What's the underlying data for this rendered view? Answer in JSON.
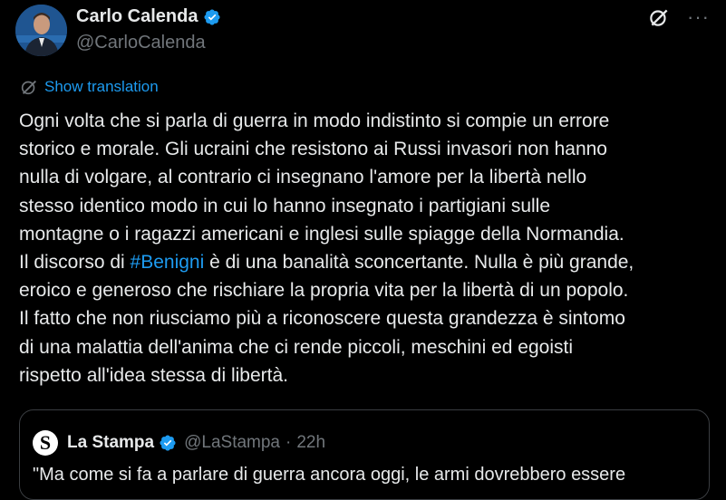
{
  "author": {
    "display_name": "Carlo Calenda",
    "handle": "@CarloCalenda",
    "avatar_icon": "avatar-portrait",
    "verified_color": "#1d9bf0"
  },
  "actions": {
    "grok_icon": "grok-icon",
    "more_label": "···"
  },
  "translation": {
    "icon": "translate-icon",
    "label": "Show translation"
  },
  "tweet": {
    "lines": [
      "Ogni volta che si parla di guerra in modo indistinto si compie un errore",
      "storico e morale. Gli ucraini che resistono ai Russi invasori non hanno",
      "nulla di volgare, al contrario ci insegnano l'amore per la libertà nello",
      "stesso identico modo in cui lo hanno insegnato i partigiani sulle",
      "montagne o i ragazzi americani e inglesi sulle spiagge della Normandia."
    ],
    "line6_before": "Il discorso di ",
    "hashtag": "#Benigni",
    "line6_after": " è di una banalità sconcertante. Nulla è più grande,",
    "lines_after": [
      "eroico e generoso che rischiare la propria vita per la libertà di un popolo.",
      "Il fatto che non riusciamo più a riconoscere questa grandezza è sintomo",
      "di una malattia dell'anima che ci rende piccoli, meschini ed egoisti",
      "rispetto all'idea stessa di libertà."
    ],
    "link_color": "#1d9bf0"
  },
  "quote": {
    "logo_letter": "S",
    "name": "La Stampa",
    "handle": "@LaStampa",
    "separator": "·",
    "time": "22h",
    "text": "\"Ma come si fa a parlare di guerra ancora oggi, le armi dovrebbero essere"
  }
}
